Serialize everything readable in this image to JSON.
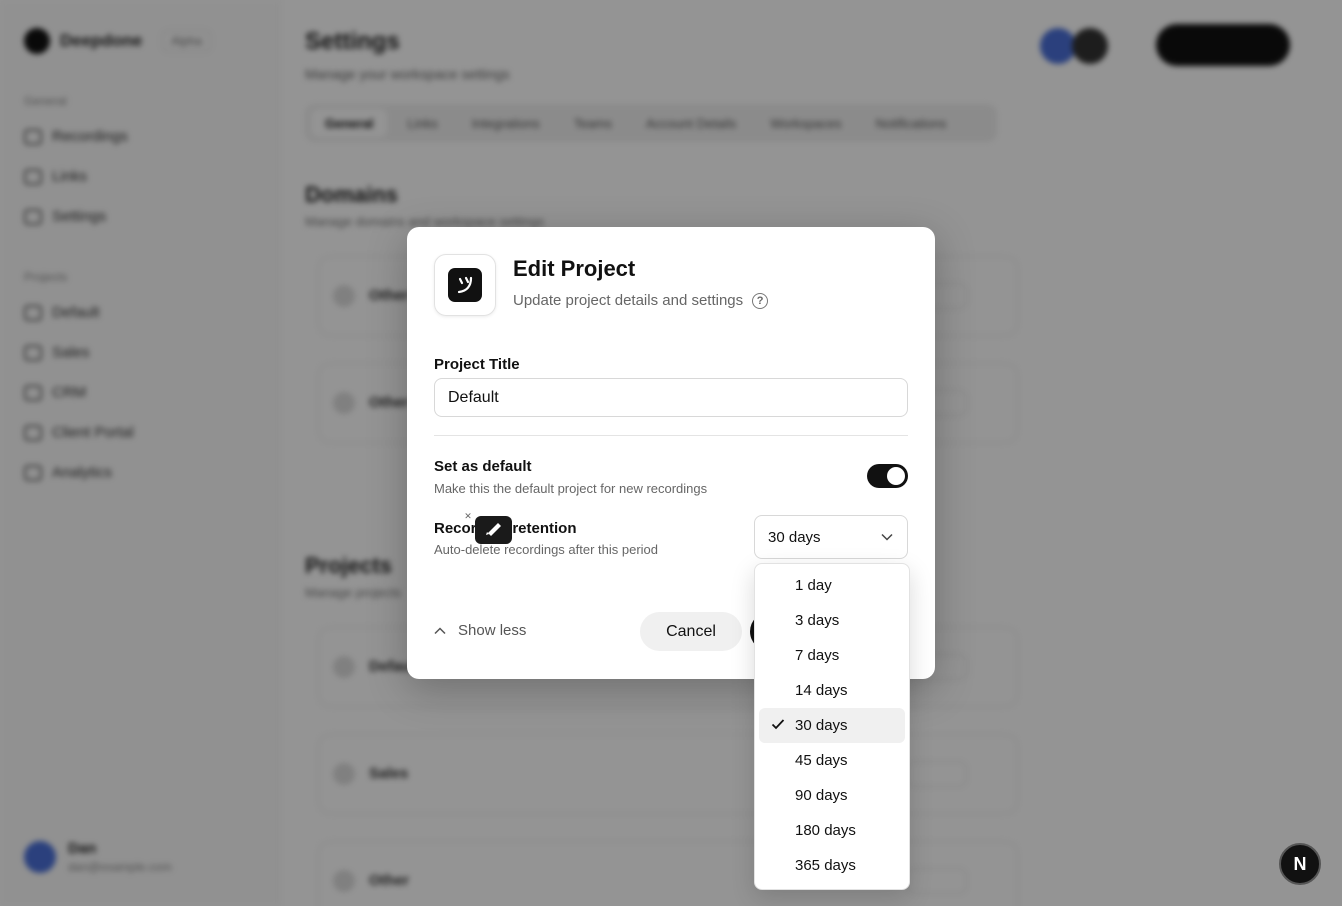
{
  "background": {
    "brand": "Deepdone",
    "brand_badge": "Alpha",
    "sections": [
      "General",
      "Projects"
    ],
    "nav_items": [
      "Recordings",
      "Links",
      "Settings"
    ],
    "project_items": [
      "Default",
      "Sales",
      "CRM",
      "Client Portal",
      "Analytics"
    ],
    "page_title": "Settings",
    "page_subtitle": "Manage your workspace settings",
    "tabs": [
      "General",
      "Links",
      "Integrations",
      "Teams",
      "Account Details",
      "Workspaces",
      "Notifications"
    ],
    "section_domains": "Domains",
    "section_domains_sub": "Manage domains and workspace settings",
    "section_projects": "Projects",
    "section_projects_sub": "Manage projects",
    "domain_cards": [
      "Other",
      "Other"
    ],
    "project_cards": [
      "Default",
      "Sales",
      "Other"
    ],
    "user_name": "Dan",
    "user_email": "dan@example.com"
  },
  "dialog": {
    "title": "Edit Project",
    "subtitle": "Update project details and settings",
    "project_title_label": "Project Title",
    "project_title_value": "Default",
    "set_default_title": "Set as default",
    "set_default_desc": "Make this the default project for new recordings",
    "set_default_on": true,
    "retention_title": "Recording retention",
    "retention_desc": "Auto-delete recordings after this period",
    "retention_selected": "30 days",
    "show_less": "Show less",
    "cancel": "Cancel"
  },
  "dropdown": {
    "options": [
      "1 day",
      "3 days",
      "7 days",
      "14 days",
      "30 days",
      "45 days",
      "90 days",
      "180 days",
      "365 days"
    ],
    "selected_index": 4
  },
  "badge": {
    "letter": "N"
  },
  "colors": {
    "overlay": "#00000066",
    "primary": "#111111",
    "selected_bg": "#f0f0f0"
  }
}
